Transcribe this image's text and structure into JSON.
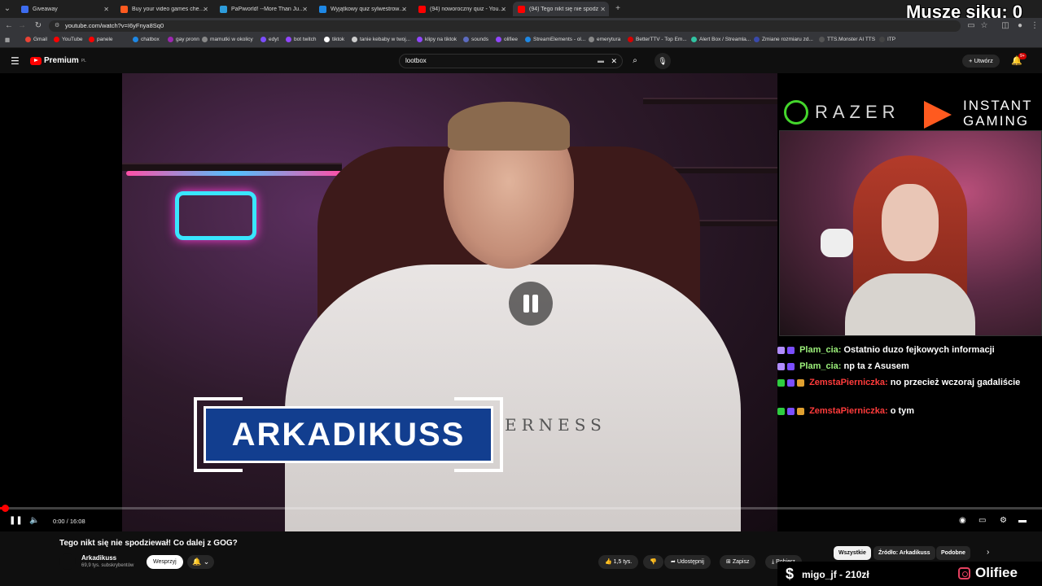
{
  "browser": {
    "tabs": [
      {
        "title": "Giveaway",
        "color": "#3d6cf0"
      },
      {
        "title": "Buy your video games cheaper - I",
        "color": "#ff5a1f"
      },
      {
        "title": "PaPiworld! --More Than Just Pa",
        "color": "#2d9cdb"
      },
      {
        "title": "Wyjątkowy quiz sylwestrowo-n",
        "color": "#1e88e5"
      },
      {
        "title": "(94) noworoczny quiz - YouTube",
        "color": "#ff0000"
      },
      {
        "title": "(94) Tego nikt się nie spodz",
        "color": "#ff0000"
      }
    ],
    "new_tab": "+",
    "url": "youtube.com/watch?v=I6yFnya8Sq0",
    "bookmarks": [
      {
        "label": "Gmail",
        "color": "#ea4335"
      },
      {
        "label": "YouTube",
        "color": "#ff0000"
      },
      {
        "label": "panele",
        "color": "#ff0000"
      },
      {
        "label": "chatbox",
        "color": "#1e88e5"
      },
      {
        "label": "gay pronn",
        "color": "#9c27b0"
      },
      {
        "label": "mamutki w okolicy",
        "color": "#888888"
      },
      {
        "label": "edyt",
        "color": "#7c4dff"
      },
      {
        "label": "bot twitch",
        "color": "#9146ff"
      },
      {
        "label": "tiktok",
        "color": "#ffffff"
      },
      {
        "label": "tanie kebaby w twoj...",
        "color": "#cccccc"
      },
      {
        "label": "klipy na tiktok",
        "color": "#9146ff"
      },
      {
        "label": "sounds",
        "color": "#5c6bc0"
      },
      {
        "label": "olifiee",
        "color": "#9146ff"
      },
      {
        "label": "StreamElements - ol...",
        "color": "#1e88e5"
      },
      {
        "label": "emerytura",
        "color": "#888888"
      },
      {
        "label": "BetterTTV - Top Em...",
        "color": "#d50000"
      },
      {
        "label": "Alert Box / Streamla...",
        "color": "#31c3a2"
      },
      {
        "label": "Zmiane rozmiaru zd...",
        "color": "#3949ab"
      },
      {
        "label": "TTS.Monster AI TTS",
        "color": "#555555"
      },
      {
        "label": "ITP",
        "color": "#444444"
      }
    ]
  },
  "overlay_counter": "Muszę siku: 0",
  "youtube": {
    "logo": "Premium",
    "logo_region": "PL",
    "search_value": "lootbox",
    "create_label": "Utwórz",
    "notifications_badge": "9+"
  },
  "video": {
    "nameplate": "ARKADIKUSS",
    "shirt_print": "ERNESS",
    "time": "0:00 / 16:08",
    "progress": 0.0
  },
  "stream": {
    "sponsor1": "RAZER",
    "sponsor2_line1": "INSTANT",
    "sponsor2_line2": "GAMING",
    "chat": [
      {
        "user": "Plam_cia:",
        "msg": "Ostatnio duzo fejkowych informacji",
        "user_color": "#9cf07a"
      },
      {
        "user": "Plam_cia:",
        "msg": "np ta z Asusem",
        "user_color": "#9cf07a"
      },
      {
        "user": "ZemstaPierniczka:",
        "msg": "no przecież wczoraj gadaliście",
        "user_color": "#ff3b3b"
      },
      {
        "user": "ZemstaPierniczka:",
        "msg": "o tym",
        "user_color": "#ff3b3b"
      }
    ],
    "donor": "migo_jf - 210zł",
    "instagram": "Olifiee"
  },
  "below": {
    "title": "Tego nikt się nie spodziewał! Co dalej z GOG?",
    "channel": "Arkadikuss",
    "subscribers": "69,9 tys. subskrybentów",
    "support_label": "Wesprzyj",
    "likes": "1,5 tys.",
    "share_label": "Udostępnij",
    "save_label": "Zapisz",
    "download_label": "Pobierz",
    "chips": [
      "Wszystkie",
      "Źródło: Arkadikuss",
      "Podobne"
    ]
  }
}
